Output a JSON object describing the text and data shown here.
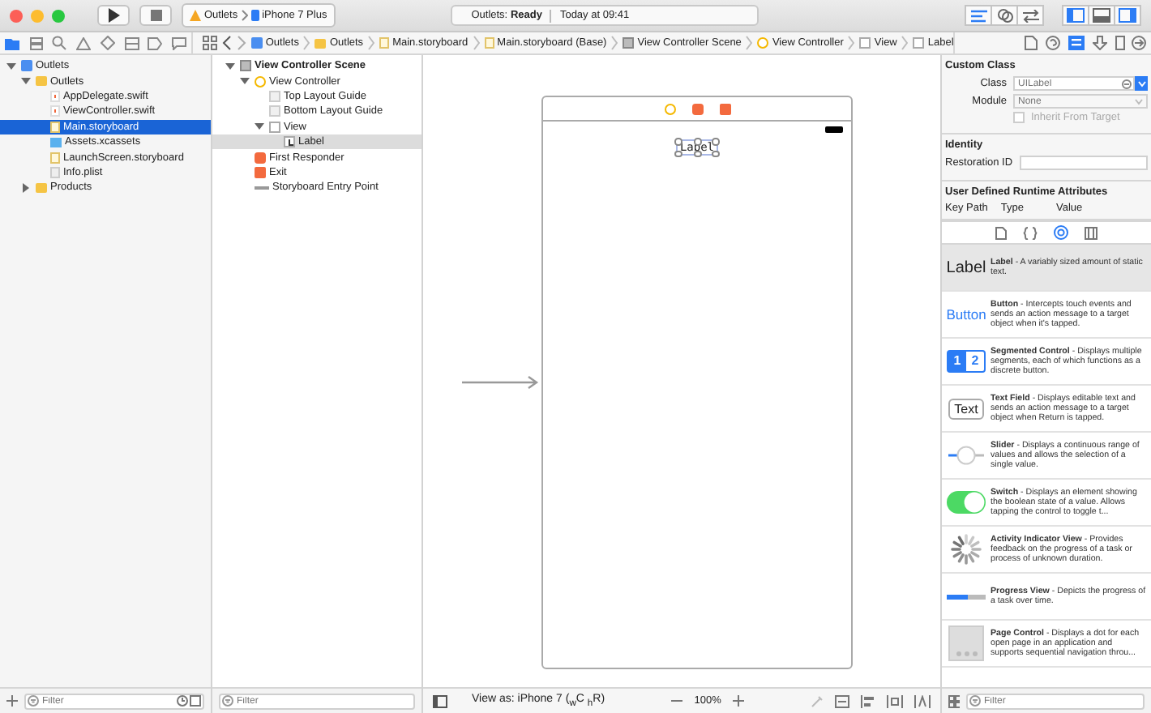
{
  "toolbar": {
    "scheme": "Outlets",
    "device": "iPhone 7 Plus",
    "status": "Outlets: **Ready**",
    "time": "Today at 09:41"
  },
  "jump_bar": [
    {
      "kind": "project",
      "label": "Outlets"
    },
    {
      "kind": "folder",
      "label": "Outlets"
    },
    {
      "kind": "storyboard",
      "label": "Main.storyboard"
    },
    {
      "kind": "storyboard",
      "label": "Main.storyboard (Base)"
    },
    {
      "kind": "scene",
      "label": "View Controller Scene"
    },
    {
      "kind": "vc",
      "label": "View Controller"
    },
    {
      "kind": "view",
      "label": "View"
    },
    {
      "kind": "label",
      "label": "Label"
    }
  ],
  "navigator": {
    "tree": [
      {
        "kind": "project",
        "label": "Outlets",
        "selected": false,
        "expanded": true,
        "children": [
          {
            "kind": "folder",
            "label": "Outlets",
            "selected": false,
            "expanded": true,
            "children": [
              {
                "kind": "swift",
                "label": "AppDelegate.swift",
                "selected": false
              },
              {
                "kind": "swift",
                "label": "ViewController.swift",
                "selected": false
              },
              {
                "kind": "storyboard",
                "label": "Main.storyboard",
                "selected": true
              },
              {
                "kind": "assets",
                "label": "Assets.xcassets",
                "selected": false
              },
              {
                "kind": "storyboard",
                "label": "LaunchScreen.storyboard",
                "selected": false
              },
              {
                "kind": "plist",
                "label": "Info.plist",
                "selected": false
              }
            ]
          },
          {
            "kind": "folder",
            "label": "Products",
            "selected": false,
            "expanded": false
          }
        ]
      }
    ],
    "filter_placeholder": "Filter"
  },
  "outline": {
    "tree": [
      {
        "kind": "scene",
        "label": "View Controller Scene",
        "selected": false,
        "expanded": true,
        "children": [
          {
            "kind": "vc",
            "label": "View Controller",
            "selected": false,
            "expanded": true,
            "children": [
              {
                "kind": "guide",
                "label": "Top Layout Guide",
                "selected": false
              },
              {
                "kind": "guide",
                "label": "Bottom Layout Guide",
                "selected": false
              },
              {
                "kind": "view",
                "label": "View",
                "selected": false,
                "expanded": true,
                "children": [
                  {
                    "kind": "label",
                    "label": "Label",
                    "selected": true
                  }
                ]
              }
            ]
          },
          {
            "kind": "responder",
            "label": "First Responder",
            "selected": false
          },
          {
            "kind": "exit",
            "label": "Exit",
            "selected": false
          },
          {
            "kind": "entry",
            "label": "Storyboard Entry Point",
            "selected": false
          }
        ]
      }
    ],
    "filter_placeholder": "Filter"
  },
  "canvas": {
    "label_text": "Label",
    "view_as": "View as: iPhone 7 ($_{w}$C $_{h}$R)",
    "zoom": "100%"
  },
  "inspector": {
    "custom_class": {
      "title": "Custom Class",
      "class_label": "Class",
      "class_placeholder": "UILabel",
      "module_label": "Module",
      "module_placeholder": "None",
      "inherit_label": "Inherit From Target",
      "inherit_checked": false
    },
    "identity": {
      "title": "Identity",
      "restoration_label": "Restoration ID"
    },
    "runtime": {
      "title": "User Defined Runtime Attributes",
      "columns": [
        "Key Path",
        "Type",
        "Value"
      ]
    }
  },
  "library": {
    "items": [
      {
        "kind": "label",
        "preview": "Label",
        "title": "Label",
        "desc": " - A variably sized amount of static text.",
        "selected": true
      },
      {
        "kind": "button",
        "preview": "Button",
        "title": "Button",
        "desc": " - Intercepts touch events and sends an action message to a target object when it's tapped.",
        "selected": false
      },
      {
        "kind": "segmented",
        "segments": [
          "1",
          "2"
        ],
        "title": "Segmented Control",
        "desc": " - Displays multiple segments, each of which functions as a discrete button.",
        "selected": false
      },
      {
        "kind": "textfield",
        "preview": "Text",
        "title": "Text Field",
        "desc": " - Displays editable text and sends an action message to a target object when Return is tapped.",
        "selected": false
      },
      {
        "kind": "slider",
        "title": "Slider",
        "desc": " - Displays a continuous range of values and allows the selection of a single value.",
        "selected": false
      },
      {
        "kind": "switch",
        "title": "Switch",
        "desc": " - Displays an element showing the boolean state of a value. Allows tapping the control to toggle t...",
        "selected": false
      },
      {
        "kind": "activity",
        "title": "Activity Indicator View",
        "desc": " - Provides feedback on the progress of a task or process of unknown duration.",
        "selected": false
      },
      {
        "kind": "progress",
        "title": "Progress View",
        "desc": " - Depicts the progress of a task over time.",
        "selected": false
      },
      {
        "kind": "pagecontrol",
        "title": "Page Control",
        "desc": " - Displays a dot for each open page in an application and supports sequential navigation throu...",
        "selected": false
      }
    ],
    "filter_placeholder": "Filter"
  }
}
